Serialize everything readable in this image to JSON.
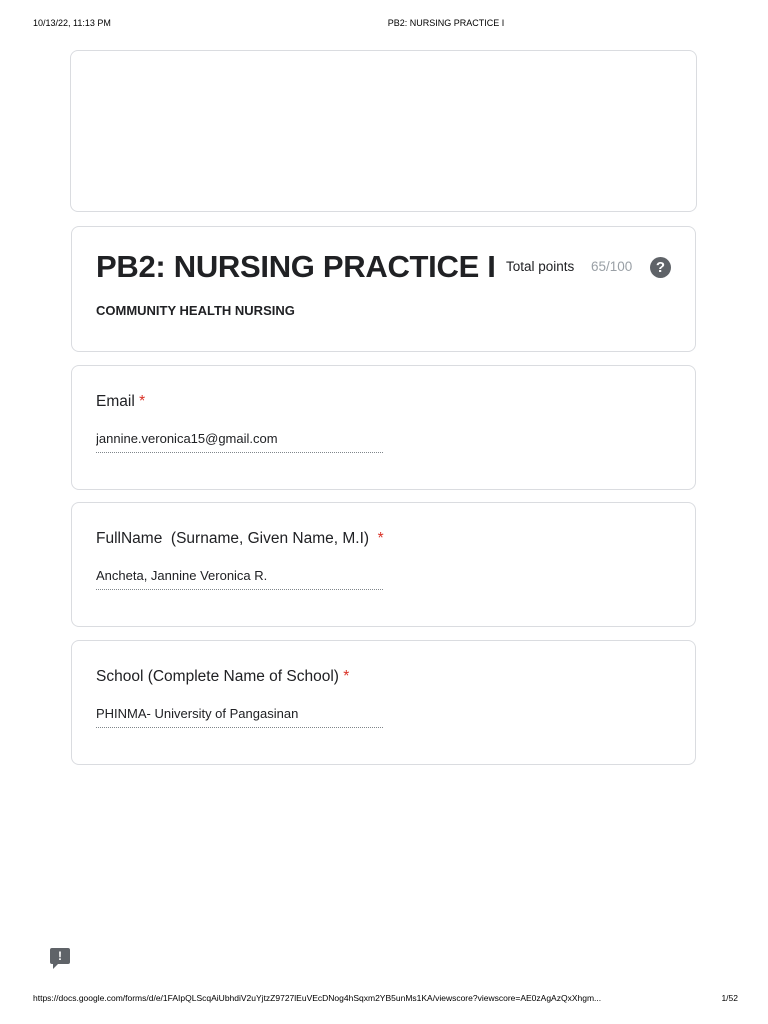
{
  "print_header": {
    "date": "10/13/22, 11:13 PM",
    "title": "PB2: NURSING PRACTICE I"
  },
  "form": {
    "title": "PB2: NURSING PRACTICE I",
    "description": "COMMUNITY HEALTH NURSING",
    "total_points_label": "Total points",
    "total_points_value": "65/100",
    "help_icon": "help-circle-icon"
  },
  "questions": [
    {
      "label": "Email",
      "required_marker": "*",
      "answer": "jannine.veronica15@gmail.com"
    },
    {
      "label": "FullName  (Surname, Given Name, M.I)",
      "required_marker": "*",
      "answer": "Ancheta, Jannine Veronica R."
    },
    {
      "label": "School (Complete Name of School)",
      "required_marker": "*",
      "answer": "PHINMA- University of Pangasinan"
    }
  ],
  "feedback_icon": "report-feedback-icon",
  "print_footer": {
    "url": "https://docs.google.com/forms/d/e/1FAIpQLScqAiUbhdiV2uYjtzZ9727lEuVEcDNog4hSqxm2YB5unMs1KA/viewscore?viewscore=AE0zAgAzQxXhgm...",
    "page": "1/52"
  },
  "colors": {
    "required": "#d93025",
    "muted": "#9aa0a6",
    "border": "#dadce0",
    "icon": "#5f6368"
  }
}
